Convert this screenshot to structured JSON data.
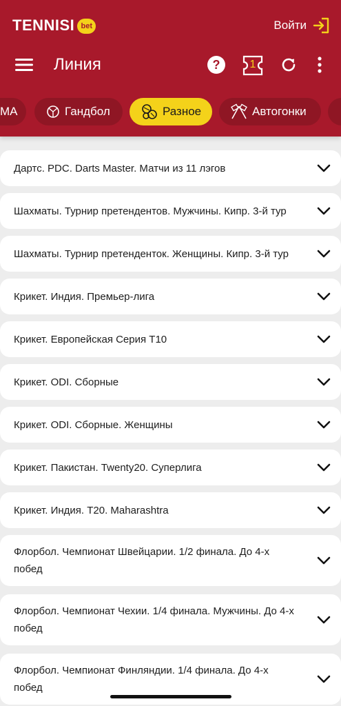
{
  "brand": {
    "name": "TENNISI",
    "badge": "bet"
  },
  "header": {
    "login_label": "Войти",
    "title": "Линия",
    "coupon_count": "1"
  },
  "chips": [
    {
      "label": "MA",
      "icon": "mma-icon"
    },
    {
      "label": "Гандбол",
      "icon": "handball-icon"
    },
    {
      "label": "Разное",
      "icon": "misc-balls-icon",
      "active": true
    },
    {
      "label": "Автогонки",
      "icon": "racing-flags-icon"
    }
  ],
  "items": [
    {
      "label": "Дартс. PDC. Darts Master. Матчи из 11 лэгов"
    },
    {
      "label": "Шахматы. Турнир претендентов. Мужчины. Кипр. 3-й тур"
    },
    {
      "label": "Шахматы. Турнир претенденток. Женщины. Кипр. 3-й тур"
    },
    {
      "label": "Крикет. Индия. Премьер-лига"
    },
    {
      "label": "Крикет. Европейская Серия Т10"
    },
    {
      "label": "Крикет. ODI. Сборные"
    },
    {
      "label": "Крикет. ODI. Сборные. Женщины"
    },
    {
      "label": "Крикет. Пакистан. Twenty20. Суперлига"
    },
    {
      "label": "Крикет. Индия. T20. Maharashtra"
    },
    {
      "label": "Флорбол. Чемпионат Швейцарии. 1/2 финала. До 4-х побед"
    },
    {
      "label": "Флорбол. Чемпионат Чехии. 1/4 финала. Мужчины. До 4-х побед"
    },
    {
      "label": "Флорбол. Чемпионат Финляндии. 1/4 финала. До 4-х побед"
    }
  ],
  "colors": {
    "primary": "#a8192b",
    "accent": "#f4d21a",
    "chip": "#8f1624",
    "background": "#ededed"
  }
}
